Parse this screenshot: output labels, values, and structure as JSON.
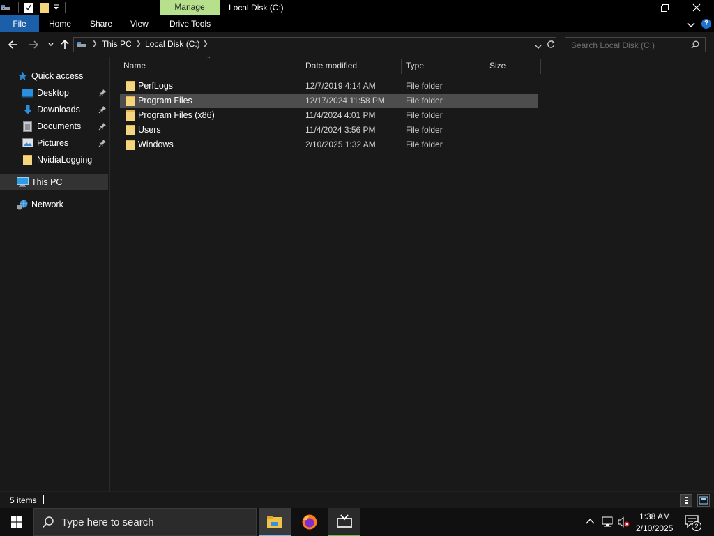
{
  "window": {
    "title": "Local Disk (C:)",
    "manage_tab": "Manage",
    "controls": [
      "minimize",
      "maximize",
      "close"
    ]
  },
  "ribbon": {
    "file": "File",
    "tabs": [
      "Home",
      "Share",
      "View",
      "Drive Tools"
    ]
  },
  "address": {
    "crumbs": [
      "This PC",
      "Local Disk (C:)"
    ],
    "search_placeholder": "Search Local Disk (C:)"
  },
  "nav_pane": {
    "quick_access": "Quick access",
    "quick_items": [
      {
        "label": "Desktop",
        "icon": "desktop-icon",
        "pinned": true
      },
      {
        "label": "Downloads",
        "icon": "downloads-icon",
        "pinned": true
      },
      {
        "label": "Documents",
        "icon": "documents-icon",
        "pinned": true
      },
      {
        "label": "Pictures",
        "icon": "pictures-icon",
        "pinned": true
      },
      {
        "label": "NvidiaLogging",
        "icon": "folder-icon",
        "pinned": false
      }
    ],
    "this_pc": "This PC",
    "network": "Network"
  },
  "file_list": {
    "columns": [
      "Name",
      "Date modified",
      "Type",
      "Size"
    ],
    "rows": [
      {
        "name": "PerfLogs",
        "date": "12/7/2019 4:14 AM",
        "type": "File folder",
        "size": ""
      },
      {
        "name": "Program Files",
        "date": "12/17/2024 11:58 PM",
        "type": "File folder",
        "size": "",
        "selected": true
      },
      {
        "name": "Program Files (x86)",
        "date": "11/4/2024 4:01 PM",
        "type": "File folder",
        "size": ""
      },
      {
        "name": "Users",
        "date": "11/4/2024 3:56 PM",
        "type": "File folder",
        "size": ""
      },
      {
        "name": "Windows",
        "date": "2/10/2025 1:32 AM",
        "type": "File folder",
        "size": ""
      }
    ]
  },
  "status_bar": {
    "item_count": "5 items"
  },
  "taskbar": {
    "search_text": "Type here to search",
    "apps": [
      "file-explorer-icon",
      "firefox-icon",
      "app-icon"
    ],
    "time": "1:38 AM",
    "date": "2/10/2025",
    "notification_count": "2"
  },
  "colors": {
    "accent": "#1a5fa8",
    "manage_tab": "#b7e08d",
    "background": "#191919",
    "selection": "#4d4d4d",
    "folder": "#f4d47c"
  }
}
